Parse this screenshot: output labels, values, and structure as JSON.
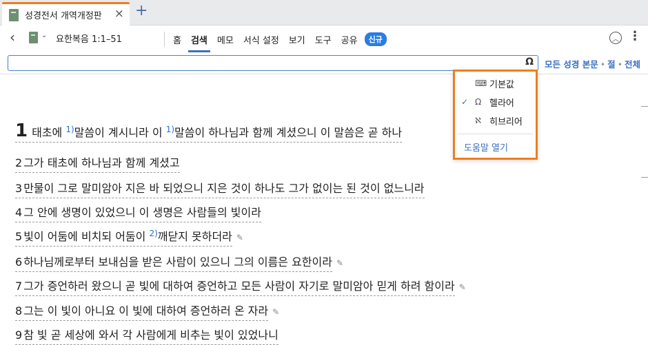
{
  "tab": {
    "title": "성경전서 개역개정판",
    "close": "×",
    "new_tab": "+"
  },
  "toolbar": {
    "back": "‹",
    "reference": "요한복음 1:1–51",
    "caret": "⌄",
    "menu": [
      "홈",
      "검색",
      "메모",
      "서식 설정",
      "보기",
      "도구",
      "공유"
    ],
    "new_badge": "신규",
    "collapse": "︿",
    "more": "⋮"
  },
  "search": {
    "value": "",
    "keyboard_icon": "Ω",
    "scope_all_text": "모든 성경 본문",
    "scope_verse": "절",
    "scope_all": "전체",
    "sep": "•"
  },
  "dropdown": {
    "items": [
      {
        "label": "기본값",
        "icon": "⌨",
        "checked": false
      },
      {
        "label": "헬라어",
        "icon": "Ω",
        "checked": true
      },
      {
        "label": "히브리어",
        "icon": "ℵ",
        "checked": false
      }
    ],
    "check": "✓",
    "help": "도움말 열기"
  },
  "verses": [
    {
      "num": "1",
      "parts": [
        "태초에 ",
        "1)",
        "말씀이 계시니라 이 ",
        "1)",
        "말씀이 하나님과 함께 계셨으니 이 말씀은 곧 하나"
      ],
      "pencil": false
    },
    {
      "num": "2",
      "text": "그가 태초에 하나님과 함께 계셨고",
      "pencil": false
    },
    {
      "num": "3",
      "text": "만물이 그로 말미암아 지은 바 되었으니 지은 것이 하나도 그가 없이는 된 것이 없느니라",
      "pencil": false
    },
    {
      "num": "4",
      "text": "그 안에 생명이 있었으니 이 생명은 사람들의 빛이라",
      "pencil": false
    },
    {
      "num": "5",
      "parts": [
        "빛이 어둠에 비치되 어둠이 ",
        "2)",
        "깨닫지 못하더라"
      ],
      "pencil": true
    },
    {
      "num": "6",
      "text": "하나님께로부터 보내심을 받은 사람이 있으니 그의 이름은 요한이라",
      "pencil": true
    },
    {
      "num": "7",
      "text": "그가 증언하러 왔으니 곧 빛에 대하여 증언하고 모든 사람이 자기로 말미암아 믿게 하려 함이라",
      "pencil": true
    },
    {
      "num": "8",
      "text": "그는 이 빛이 아니요 이 빛에 대하여 증언하러 온 자라",
      "pencil": true
    },
    {
      "num": "9",
      "text": "참 빛 곧 세상에 와서 각 사람에게 비추는 빛이 있었나니",
      "pencil": false
    }
  ],
  "pencil_glyph": "✎"
}
